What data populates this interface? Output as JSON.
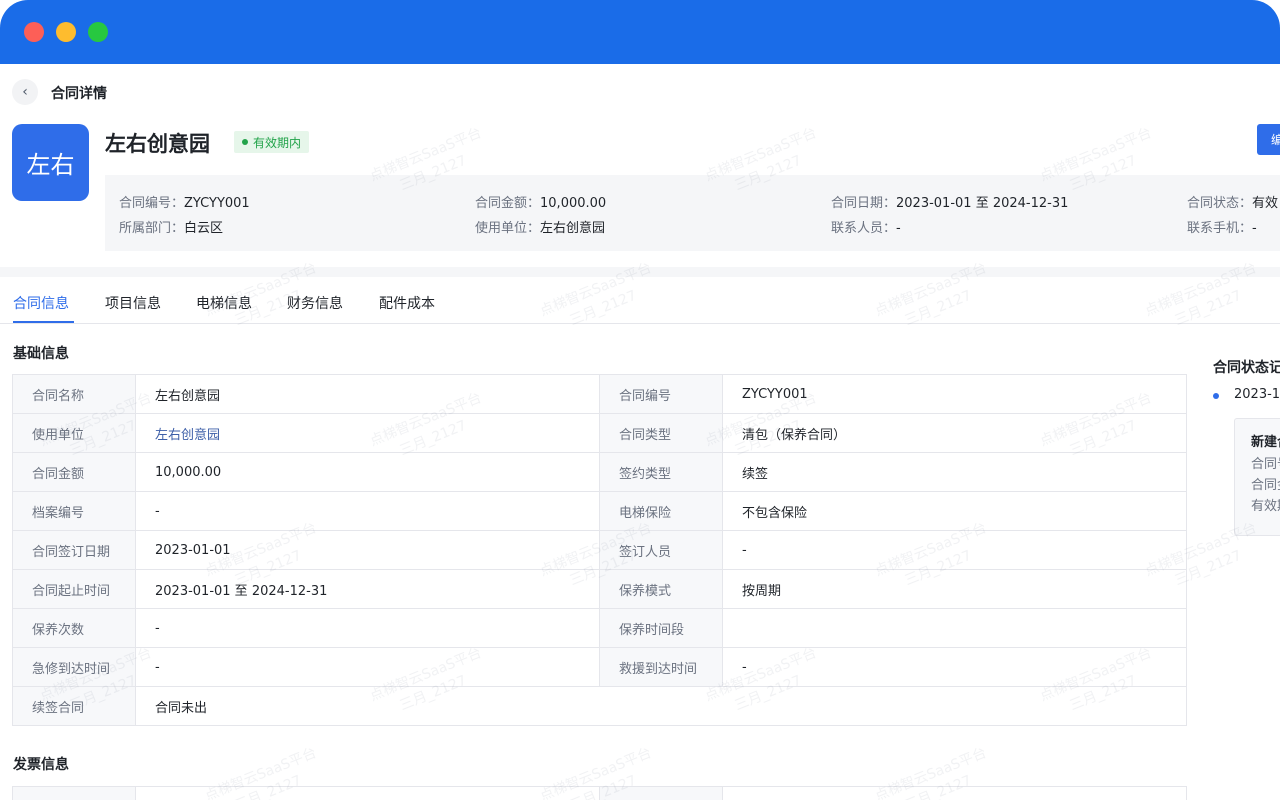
{
  "window": {
    "controls": [
      "close",
      "minimize",
      "maximize"
    ]
  },
  "header": {
    "back_icon": "chevron-left-icon",
    "title": "合同详情"
  },
  "project": {
    "logo_text": "左右",
    "name": "左右创意园",
    "status": "有效期内",
    "edit_label": "编"
  },
  "summary": {
    "contract_no": {
      "label": "合同编号：",
      "value": "ZYCYY001"
    },
    "amount": {
      "label": "合同金额：",
      "value": "10,000.00"
    },
    "date": {
      "label": "合同日期：",
      "value": "2023-01-01 至 2024-12-31"
    },
    "state": {
      "label": "合同状态：",
      "value": "有效"
    },
    "dept": {
      "label": "所属部门：",
      "value": "白云区"
    },
    "unit": {
      "label": "使用单位：",
      "value": "左右创意园"
    },
    "contact": {
      "label": "联系人员：",
      "value": "-"
    },
    "phone": {
      "label": "联系手机：",
      "value": "-"
    }
  },
  "tabs": [
    "合同信息",
    "项目信息",
    "电梯信息",
    "财务信息",
    "配件成本"
  ],
  "basic": {
    "title": "基础信息",
    "rows": [
      [
        "合同名称",
        "左右创意园",
        "合同编号",
        "ZYCYY001"
      ],
      [
        "使用单位",
        "左右创意园",
        "合同类型",
        "清包（保养合同）"
      ],
      [
        "合同金额",
        "10,000.00",
        "签约类型",
        "续签"
      ],
      [
        "档案编号",
        "-",
        "电梯保险",
        "不包含保险"
      ],
      [
        "合同签订日期",
        "2023-01-01",
        "签订人员",
        "-"
      ],
      [
        "合同起止时间",
        "2023-01-01 至 2024-12-31",
        "保养模式",
        "按周期"
      ],
      [
        "保养次数",
        "-",
        "保养时间段",
        ""
      ],
      [
        "急修到达时间",
        "-",
        "救援到达时间",
        "-"
      ],
      [
        "续签合同",
        "合同未出",
        "",
        ""
      ]
    ]
  },
  "invoice": {
    "title": "发票信息"
  },
  "side": {
    "title": "合同状态记",
    "date": "2023-1",
    "card_title": "新建合",
    "card_lines": [
      "合同号",
      "合同金",
      "有效期"
    ]
  },
  "watermark": {
    "line1": "点梯智云SaaS平台",
    "line2": "三月_2127"
  }
}
